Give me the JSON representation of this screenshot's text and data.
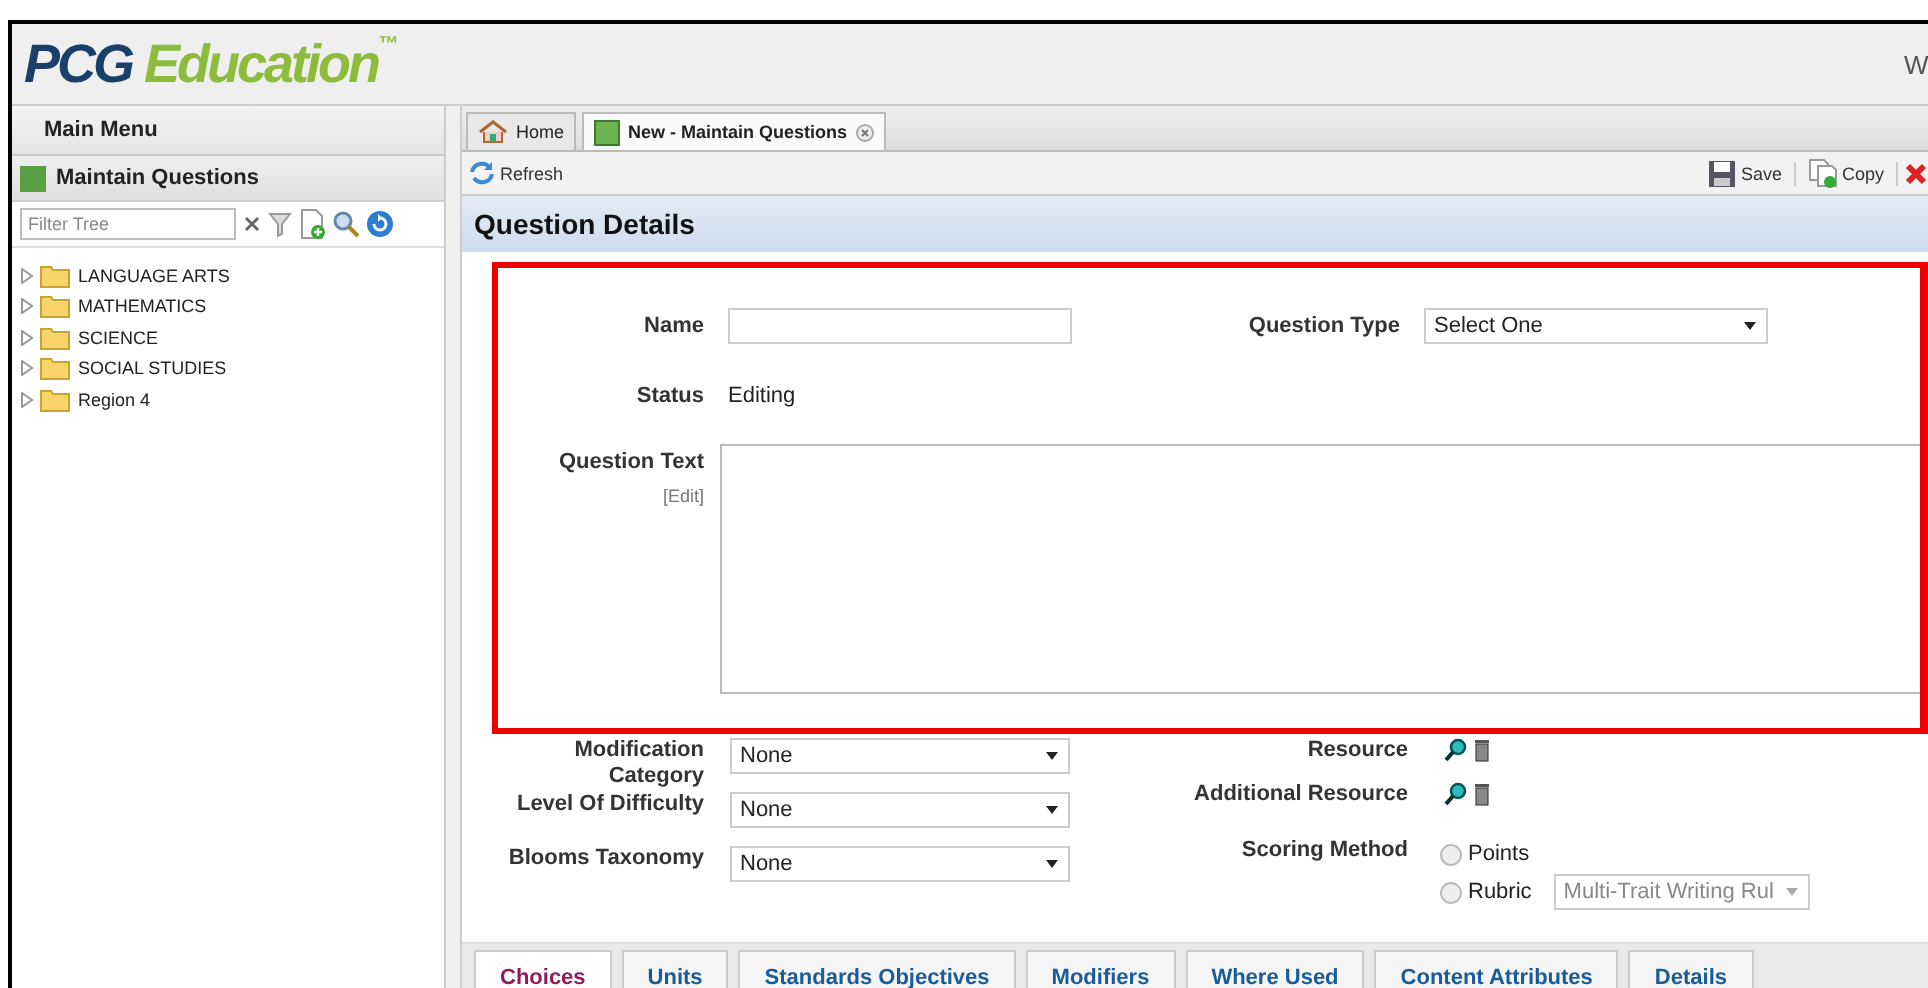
{
  "header": {
    "logo": {
      "primary": "PCG",
      "secondary": "Education",
      "mark": "™"
    },
    "user_text": "W"
  },
  "sidebar": {
    "title": "Main Menu",
    "module": "Maintain Questions",
    "filter": {
      "placeholder": "Filter Tree"
    },
    "tree": [
      {
        "label": "LANGUAGE ARTS",
        "expanded": false
      },
      {
        "label": "MATHEMATICS",
        "expanded": false
      },
      {
        "label": "SCIENCE",
        "expanded": false
      },
      {
        "label": "SOCIAL STUDIES",
        "expanded": false
      },
      {
        "label": "Region 4",
        "expanded": false
      }
    ]
  },
  "tabs": [
    {
      "label": "Home",
      "kind": "home",
      "selected": false,
      "closable": false
    },
    {
      "label": "New - Maintain Questions",
      "kind": "module",
      "selected": true,
      "closable": true
    }
  ],
  "toolbar": {
    "left": [
      {
        "label": "Refresh",
        "kind": "refresh"
      }
    ],
    "right": [
      {
        "label": "Save",
        "kind": "save"
      },
      {
        "label": "Copy",
        "kind": "copy"
      },
      {
        "kind": "delete"
      }
    ]
  },
  "section_title": "Question Details",
  "form": {
    "name": {
      "label": "Name"
    },
    "question_type": {
      "label": "Question Type",
      "value": "Select One"
    },
    "status": {
      "label": "Status",
      "value": "Editing"
    },
    "question_text": {
      "label": "Question Text",
      "edit_link": "[Edit]"
    },
    "left_fields": [
      {
        "label": "Modification Category",
        "value": "None"
      },
      {
        "label": "Level Of Difficulty",
        "value": "None"
      },
      {
        "label": "Blooms Taxonomy",
        "value": "None"
      }
    ],
    "resources": [
      {
        "label": "Resource"
      },
      {
        "label": "Additional Resource"
      }
    ],
    "scoring": {
      "label": "Scoring Method",
      "options": [
        {
          "label": "Points",
          "checked": false
        },
        {
          "label": "Rubric",
          "checked": false
        }
      ],
      "rubric_value": "Multi-Trait Writing Rul"
    }
  },
  "bottom_tabs": [
    {
      "label": "Choices",
      "selected": true
    },
    {
      "label": "Units",
      "selected": false
    },
    {
      "label": "Standards Objectives",
      "selected": false
    },
    {
      "label": "Modifiers",
      "selected": false
    },
    {
      "label": "Where Used",
      "selected": false
    },
    {
      "label": "Content Attributes",
      "selected": false
    },
    {
      "label": "Details",
      "selected": false
    }
  ]
}
